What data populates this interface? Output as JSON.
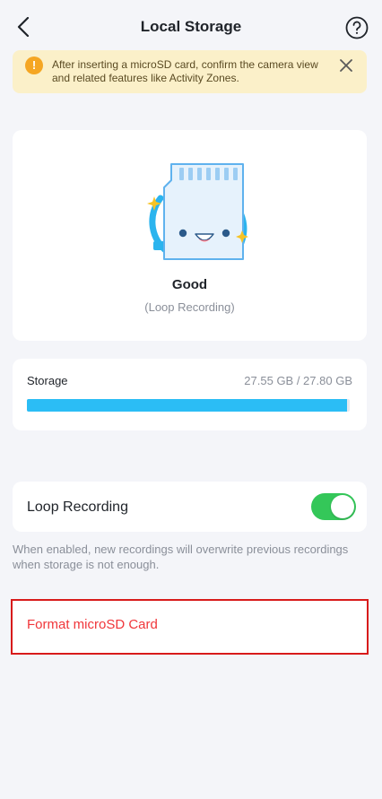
{
  "header": {
    "title": "Local Storage",
    "back_icon": "chevron-left-icon",
    "help_icon": "question-circle-icon"
  },
  "notice": {
    "text": "After inserting a microSD card, confirm the camera view and related features like Activity Zones.",
    "icon": "warning-circle-icon",
    "icon_glyph": "!",
    "close_icon": "close-icon",
    "color": "#fbf0c9",
    "icon_color": "#f5a623"
  },
  "status": {
    "title": "Good",
    "subtitle": "(Loop Recording)",
    "illustration": "sd-card-smile-illustration"
  },
  "storage": {
    "label": "Storage",
    "value": "27.55 GB / 27.80 GB",
    "used_fraction": 0.991,
    "bar_color": "#2bbdf5"
  },
  "loop_recording": {
    "label": "Loop Recording",
    "enabled": true,
    "description": "When enabled, new recordings will overwrite previous recordings when storage is not enough.",
    "toggle_color": "#34c759"
  },
  "format": {
    "label": "Format microSD Card",
    "color": "#f0363a"
  }
}
